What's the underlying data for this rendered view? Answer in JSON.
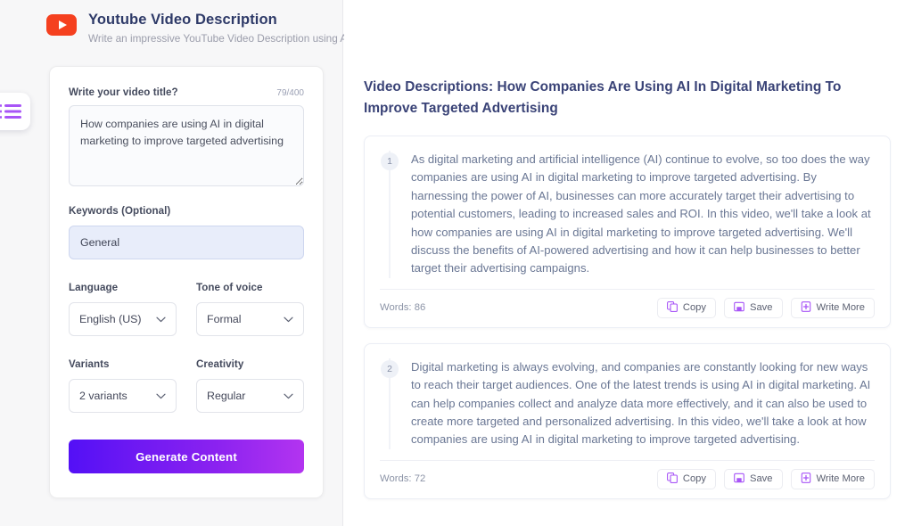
{
  "header": {
    "logo_icon": "youtube-icon",
    "title": "Youtube Video Description",
    "subtitle": "Write an impressive YouTube Video Description using AI support.",
    "info_icon": "info-icon"
  },
  "sidebar": {
    "icon": "list-icon"
  },
  "form": {
    "title_field": {
      "label": "Write your video title?",
      "counter": "79/400",
      "value": "How companies are using AI in digital marketing to improve targeted advertising",
      "placeholder": "Write your video title?"
    },
    "keywords_field": {
      "label": "Keywords (Optional)",
      "value": "General",
      "placeholder": "General"
    },
    "language_field": {
      "label": "Language",
      "value": "English (US)"
    },
    "tone_field": {
      "label": "Tone of voice",
      "value": "Formal"
    },
    "variants_field": {
      "label": "Variants",
      "value": "2 variants"
    },
    "creativity_field": {
      "label": "Creativity",
      "value": "Regular"
    },
    "generate_button": "Generate Content"
  },
  "results": {
    "title": "Video Descriptions: How Companies Are Using AI In Digital Marketing To Improve Targeted Advertising",
    "cards": [
      {
        "number": "1",
        "text": "As digital marketing and artificial intelligence (AI) continue to evolve, so too does the way companies are using AI in digital marketing to improve targeted advertising. By harnessing the power of AI, businesses can more accurately target their advertising to potential customers, leading to increased sales and ROI. In this video, we'll take a look at how companies are using AI in digital marketing to improve targeted advertising. We'll discuss the benefits of AI-powered advertising and how it can help businesses to better target their advertising campaigns.",
        "words": "Words: 86",
        "copy_label": "Copy",
        "save_label": "Save",
        "write_more_label": "Write More"
      },
      {
        "number": "2",
        "text": "Digital marketing is always evolving, and companies are constantly looking for new ways to reach their target audiences. One of the latest trends is using AI in digital marketing. AI can help companies collect and analyze data more effectively, and it can also be used to create more targeted and personalized advertising. In this video, we'll take a look at how companies are using AI in digital marketing to improve targeted advertising.",
        "words": "Words: 72",
        "copy_label": "Copy",
        "save_label": "Save",
        "write_more_label": "Write More"
      }
    ]
  },
  "colors": {
    "accent_purple": "#8a22f0",
    "brand_red": "#f5401f",
    "heading_navy": "#3a4377",
    "body_text": "#6a7794"
  }
}
